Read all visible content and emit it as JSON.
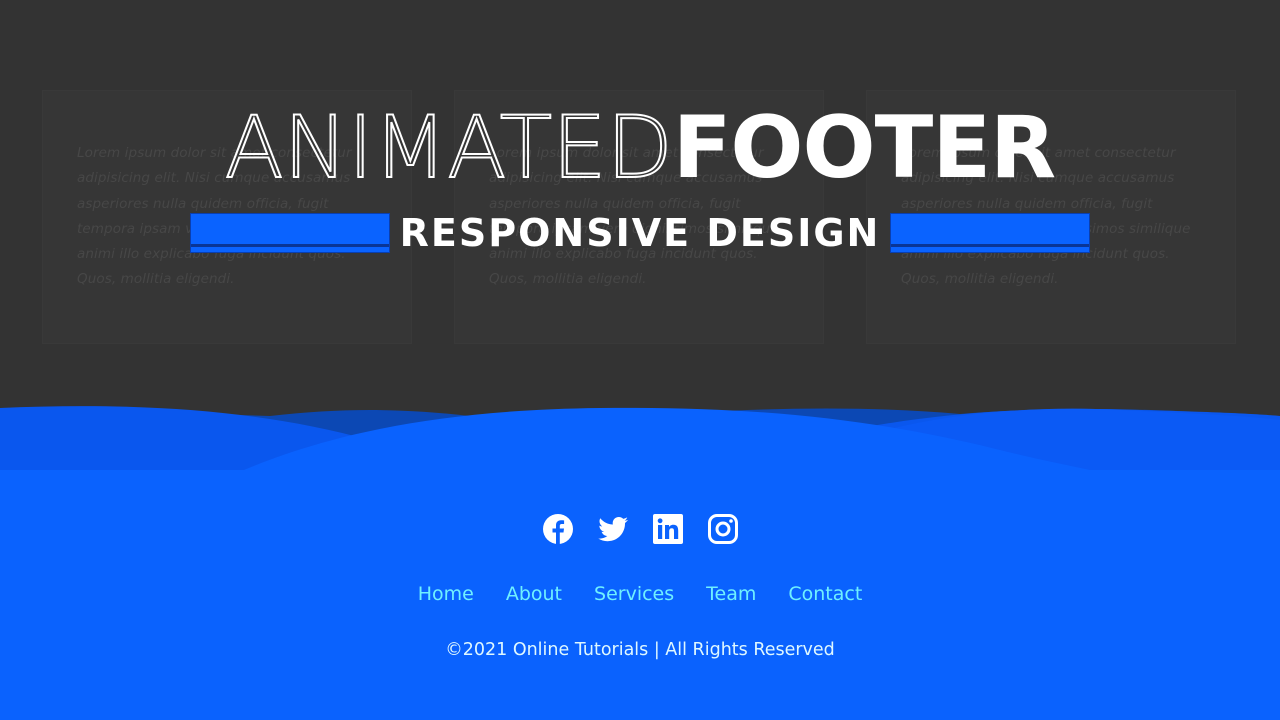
{
  "cards": [
    {
      "text": "Lorem ipsum dolor sit amet consectetur adipisicing elit. Nisi cumque accusamus asperiores nulla quidem officia, fugit tempora ipsam vero dignissimos similique animi illo explicabo fuga incidunt quos. Quos, mollitia eligendi."
    },
    {
      "text": "Lorem ipsum dolor sit amet consectetur adipisicing elit. Nisi cumque accusamus asperiores nulla quidem officia, fugit tempora ipsam vero dignissimos similique animi illo explicabo fuga incidunt quos. Quos, mollitia eligendi."
    },
    {
      "text": "Lorem ipsum dolor sit amet consectetur adipisicing elit. Nisi cumque accusamus asperiores nulla quidem officia, fugit tempora ipsam vero dignissimos similique animi illo explicabo fuga incidunt quos. Quos, mollitia eligendi."
    }
  ],
  "overlay": {
    "title_thin": "ANIMATED",
    "title_bold": "FOOTER",
    "subtitle": "RESPONSIVE DESIGN"
  },
  "footer": {
    "social_icons": [
      "facebook-icon",
      "twitter-icon",
      "linkedin-icon",
      "instagram-icon"
    ],
    "menu": [
      "Home",
      "About",
      "Services",
      "Team",
      "Contact"
    ],
    "copyright": "©2021 Online Tutorials | All Rights Reserved"
  },
  "colors": {
    "page_background": "#333333",
    "footer_blue": "#0a62fe",
    "menu_link": "#6ff0ff",
    "accent_bar": "#0a63ff"
  }
}
